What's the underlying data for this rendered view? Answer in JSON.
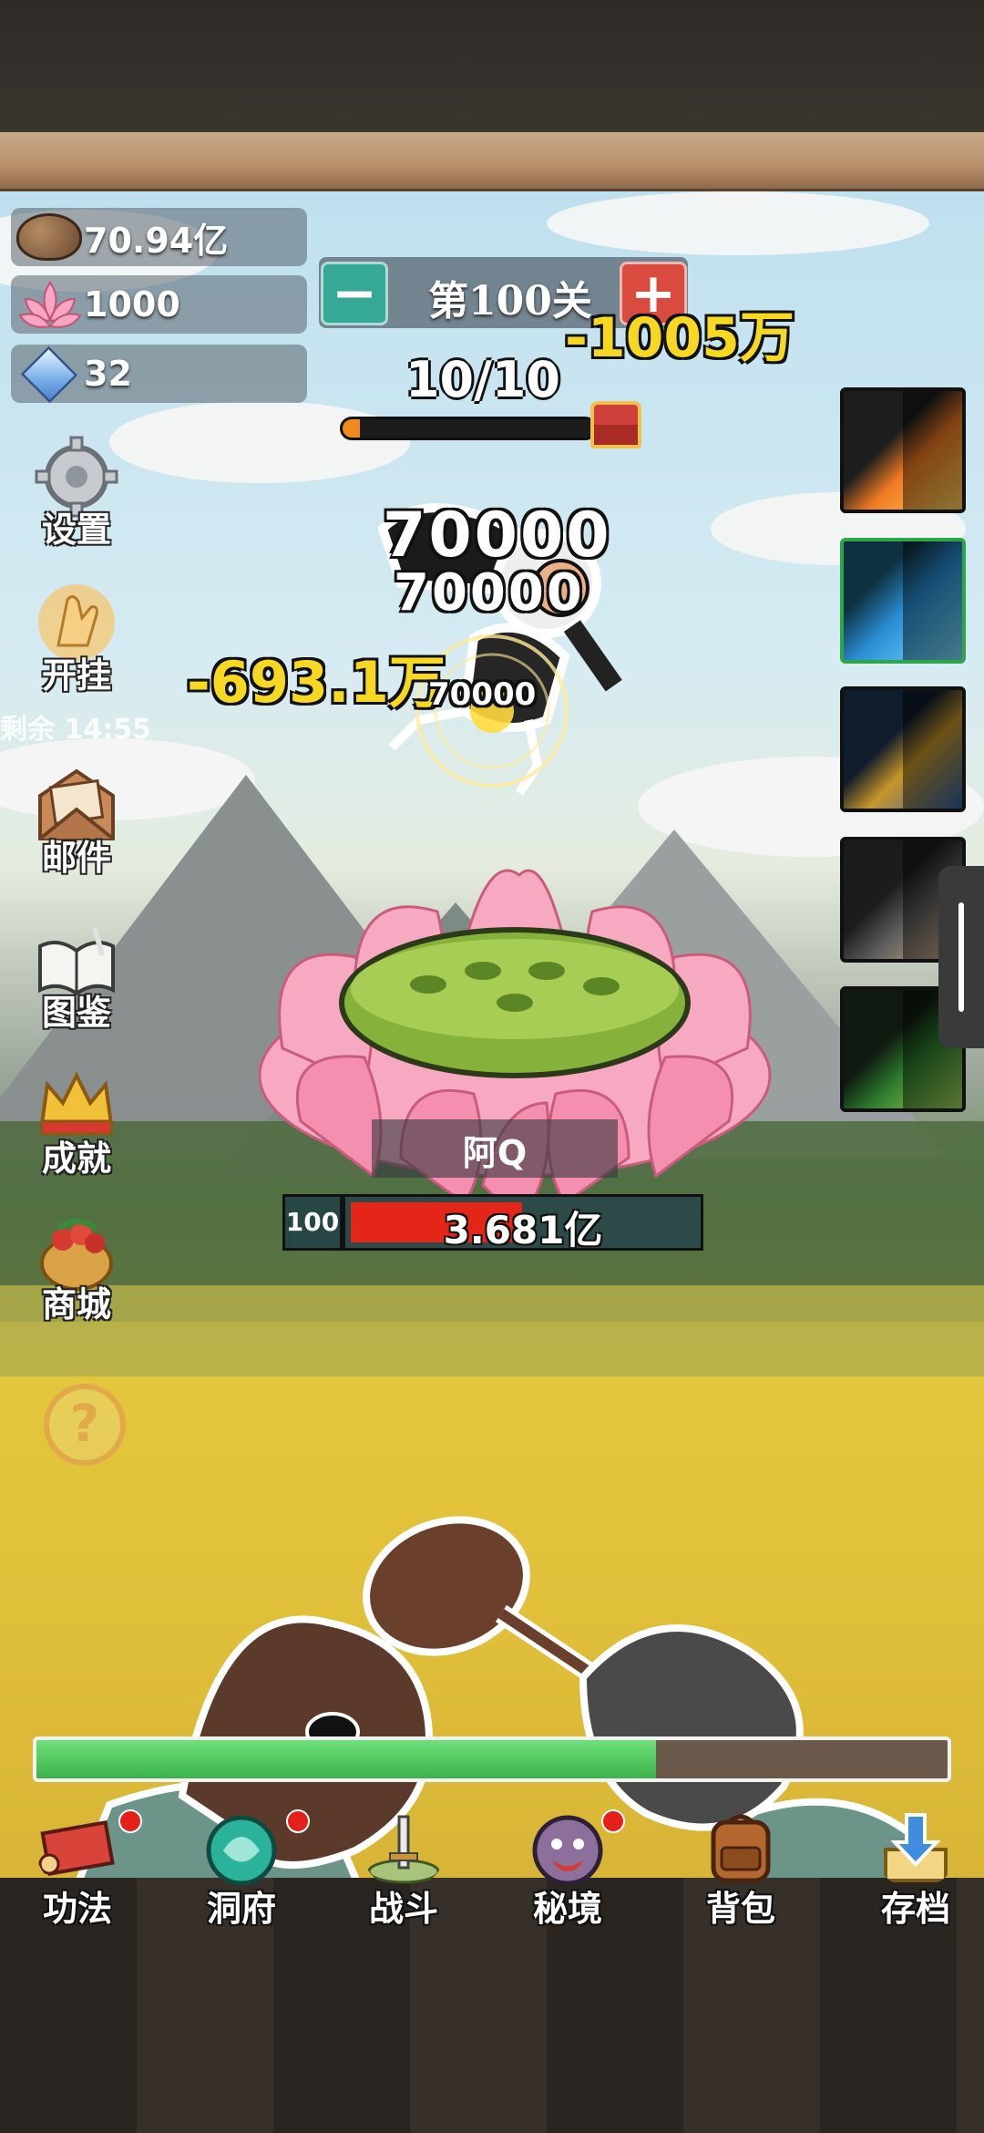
{
  "resources": {
    "spirit_stone": "70.94亿",
    "lotus": "1000",
    "crystal": "32"
  },
  "stage": {
    "minus_label": "−",
    "title": "第100关",
    "plus_label": "+",
    "wave": "10/10",
    "wave_progress": 0.07
  },
  "damage_numbers": {
    "top_right": "-1005万",
    "left": "-693.1万",
    "hit_1": "70000",
    "hit_2": "70000",
    "hit_3": "70000"
  },
  "side_menu": {
    "settings": "设置",
    "afk": "开挂",
    "afk_timer": "剩余 14:55",
    "mail": "邮件",
    "codex": "图鉴",
    "achievements": "成就",
    "shop": "商城",
    "help": "?"
  },
  "enemy": {
    "name": "阿Q",
    "level": "100",
    "hp_text": "3.681亿",
    "hp_fraction": 0.49
  },
  "player": {
    "xp_fraction": 0.68
  },
  "bottom_nav": {
    "skills": "功法",
    "cave": "洞府",
    "battle": "战斗",
    "secret_realm": "秘境",
    "backpack": "背包",
    "save": "存档"
  },
  "colors": {
    "enemy_hp": "#e32618",
    "player_xp": "#3cb24a",
    "wave_fill": "#f08a1c",
    "minus_btn": "#35a995",
    "plus_btn": "#d94a3f",
    "damage_yellow": "#f6d823"
  }
}
